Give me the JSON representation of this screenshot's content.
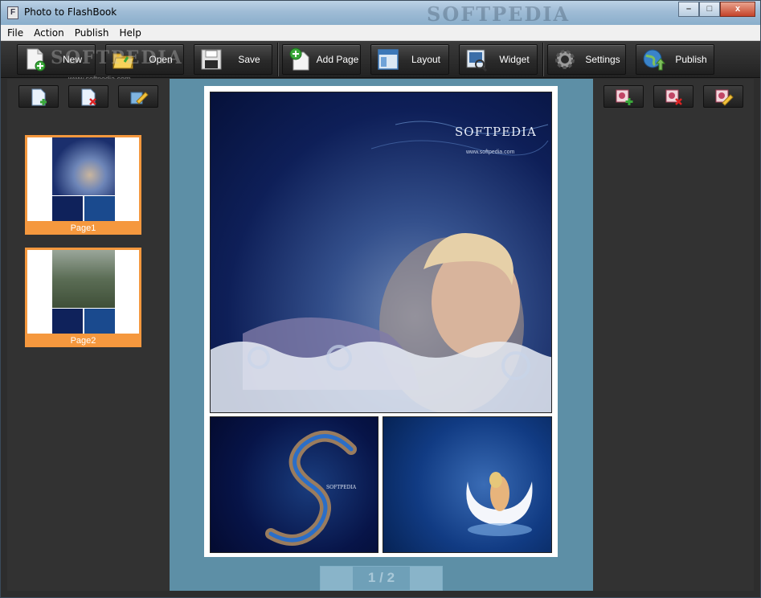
{
  "window": {
    "title": "Photo to FlashBook",
    "watermark": "SOFTPEDIA",
    "icon_letter": "F",
    "controls": {
      "minimize": "–",
      "maximize": "□",
      "close": "x"
    }
  },
  "menu": [
    "File",
    "Action",
    "Publish",
    "Help"
  ],
  "toolbar": {
    "new": "New",
    "open": "Open",
    "save": "Save",
    "add_page": "Add Page",
    "layout": "Layout",
    "widget": "Widget",
    "settings": "Settings",
    "publish": "Publish"
  },
  "softpedia_watermark": {
    "logo": "SOFTPEDIA",
    "url": "www.softpedia.com"
  },
  "pages_panel": {
    "thumbnails": [
      {
        "label": "Page1"
      },
      {
        "label": "Page2"
      }
    ]
  },
  "preview": {
    "main_photo_logo": "SOFTPEDIA",
    "main_photo_url": "www.softpedia.com",
    "photo_a_logo": "SOFTPEDIA"
  },
  "pager": {
    "current": "1",
    "total": "2",
    "separator": "/"
  },
  "colors": {
    "thumb_selected": "#f5983e",
    "workspace": "#5d8fa6",
    "panel": "#323232"
  },
  "icons": [
    "page-add-icon",
    "page-remove-icon",
    "page-edit-icon",
    "photo-add-icon",
    "photo-remove-icon",
    "photo-edit-icon"
  ]
}
